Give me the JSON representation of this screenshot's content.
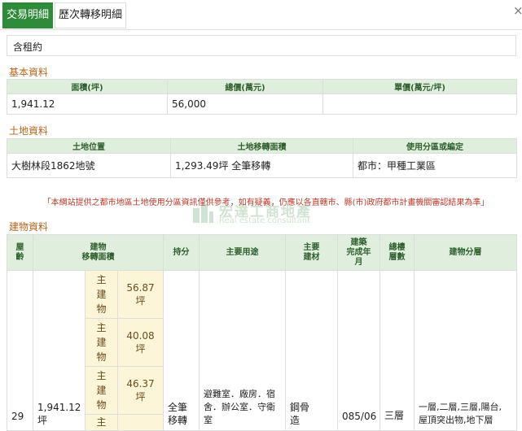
{
  "tabs": {
    "active": "交易明細",
    "inactive": "歷次轉移明細"
  },
  "close_glyph": "×",
  "remark": "含租約",
  "basic": {
    "section_title": "基本資料",
    "headers": [
      "面積(坪)",
      "總價(萬元)",
      "單價(萬元/坪)"
    ],
    "values": [
      "1,941.12",
      "56,000",
      ""
    ]
  },
  "land": {
    "section_title": "土地資料",
    "headers": [
      "土地位置",
      "土地移轉面積",
      "使用分區或編定"
    ],
    "values": [
      "大樹林段1862地號",
      "1,293.49坪 全筆移轉",
      "都市：甲種工業區"
    ]
  },
  "notice": "「本網站提供之都市地區土地使用分區資訊僅供參考，如有疑義，仍應以各直轄市、縣(市)政府都市計畫機關審認結果為準」",
  "watermark": {
    "zh": "宏達工商地產",
    "en": "Real estate consultant"
  },
  "building": {
    "section_title": "建物資料",
    "headers": {
      "age": "屋\n齡",
      "area": "建物\n移轉面積",
      "share": "持分",
      "use": "主要用途",
      "material": "主要\n建材",
      "completed": "建築\n完成年\n月",
      "floors": "總樓\n層數",
      "layers": "建物分層"
    },
    "row": {
      "age": "29",
      "area": "1,941.12\n坪",
      "main_label": "主\n建\n物",
      "sub_areas": [
        "56.87坪",
        "40.08坪",
        "46.37坪"
      ],
      "share": "全筆\n移轉",
      "use": "避難室．廠房．宿\n舍．辦公室．守衛室",
      "material": "鋼骨\n造",
      "completed": "085/06",
      "floors": "三層",
      "layers": "一層,二層,三層,陽台,\n屋頂突出物,地下層"
    }
  },
  "colors": {
    "accent": "#2e8b3a",
    "section": "#b5651d",
    "header_bg": "#dfeedd",
    "notice": "#c0392b",
    "yellow": "#fdf5d8"
  }
}
